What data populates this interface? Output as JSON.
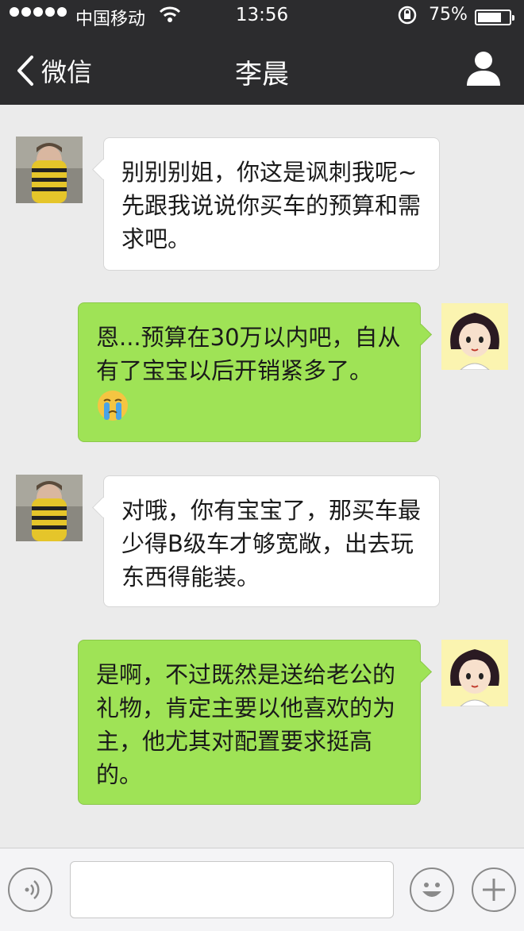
{
  "status_bar": {
    "carrier": "中国移动",
    "time": "13:56",
    "battery_pct": "75%",
    "battery_level": 0.75
  },
  "nav": {
    "back_label": "微信",
    "title": "李晨"
  },
  "messages": [
    {
      "side": "left",
      "text_lines": [
        "别别别姐，你这是讽刺我呢~",
        "先跟我说说你买车的预算和需",
        "求吧。"
      ]
    },
    {
      "side": "right",
      "text_lines": [
        "恩...预算在30万以内吧，自从",
        "有了宝宝以后开销紧多了。"
      ],
      "emoji": "crying-face"
    },
    {
      "side": "left",
      "text_lines": [
        "对哦，你有宝宝了，那买车最",
        "少得B级车才够宽敞，出去玩",
        "东西得能装。"
      ]
    },
    {
      "side": "right",
      "text_lines": [
        "是啊，不过既然是送给老公的",
        "礼物，肯定主要以他喜欢的为",
        "主，他尤其对配置要求挺高",
        "的。"
      ]
    }
  ],
  "input": {
    "value": "",
    "placeholder": ""
  },
  "icons": {
    "back": "chevron-left-icon",
    "profile": "person-icon",
    "voice": "voice-icon",
    "emoji": "smiley-icon",
    "more": "plus-icon"
  },
  "colors": {
    "header_bg": "#2c2c2e",
    "chat_bg": "#ebebeb",
    "bubble_self": "#9fe356",
    "bubble_other": "#ffffff"
  }
}
